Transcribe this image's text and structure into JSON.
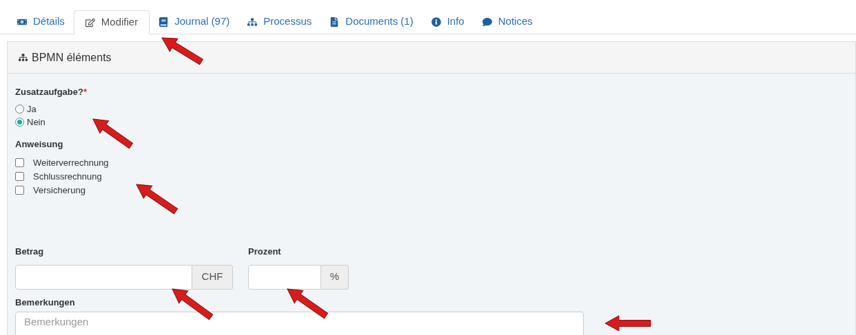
{
  "tabs": [
    {
      "label": "Détails",
      "selected": false
    },
    {
      "label": "Modifier",
      "selected": true
    },
    {
      "label": "Journal (97)",
      "selected": false
    },
    {
      "label": "Processus",
      "selected": false
    },
    {
      "label": "Documents (1)",
      "selected": false
    },
    {
      "label": "Info",
      "selected": false
    },
    {
      "label": "Notices",
      "selected": false
    }
  ],
  "panel": {
    "title": "BPMN éléments",
    "radio_group": {
      "label": "Zusatzaufgabe?",
      "required_mark": "*",
      "options": [
        {
          "label": "Ja",
          "selected": false
        },
        {
          "label": "Nein",
          "selected": true
        }
      ]
    },
    "checkbox_group": {
      "label": "Anweisung",
      "options": [
        {
          "label": "Weiterverrechnung",
          "checked": false
        },
        {
          "label": "Schlussrechnung",
          "checked": false
        },
        {
          "label": "Versicherung",
          "checked": false
        }
      ]
    },
    "amount": {
      "label": "Betrag",
      "addon": "CHF"
    },
    "percent": {
      "label": "Prozent",
      "addon": "%"
    },
    "remarks": {
      "label": "Bemerkungen",
      "placeholder": "Bemerkungen"
    }
  }
}
